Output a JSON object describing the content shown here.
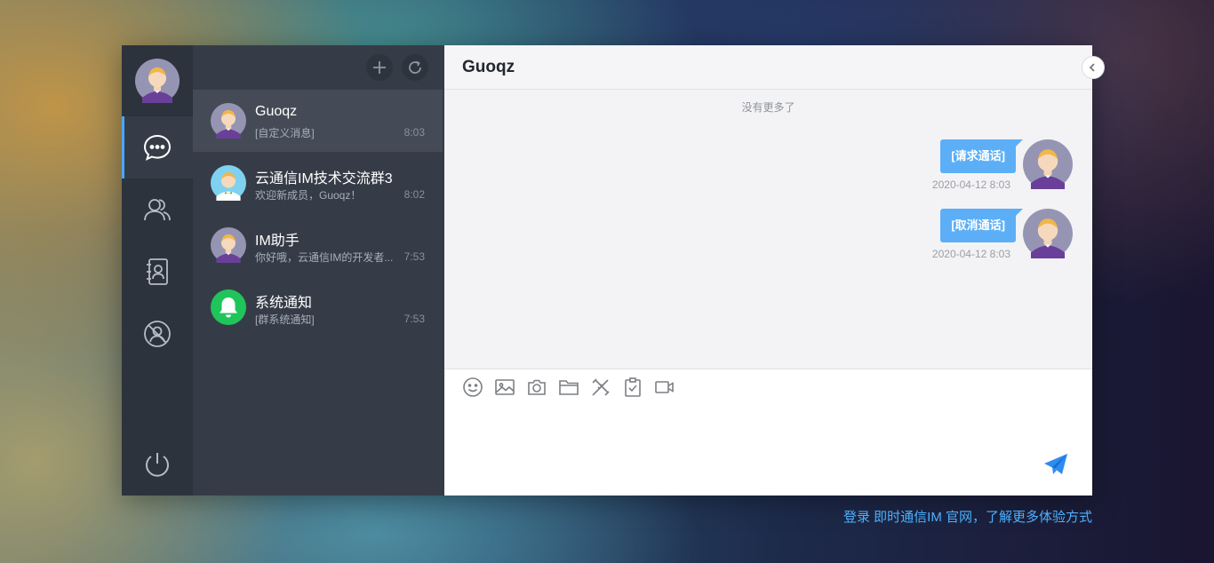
{
  "nav": {
    "items": [
      "chat",
      "contacts",
      "address-book",
      "profile"
    ],
    "power": "power"
  },
  "sessions": {
    "items": [
      {
        "name": "Guoqz",
        "preview": "[自定义消息]",
        "time": "8:03",
        "avatar": "purple-avatar"
      },
      {
        "name": "云通信IM技术交流群3",
        "preview": "欢迎新成员，Guoqz！",
        "time": "8:02",
        "avatar": "blue-avatar"
      },
      {
        "name": "IM助手",
        "preview": "你好哦，云通信IM的开发者...",
        "time": "7:53",
        "avatar": "purple-avatar"
      },
      {
        "name": "系统通知",
        "preview": "[群系统通知]",
        "time": "7:53",
        "avatar": "bell-avatar"
      }
    ]
  },
  "chat": {
    "title": "Guoqz",
    "no_more": "没有更多了",
    "messages": [
      {
        "text": "[请求通话]",
        "time": "2020-04-12 8:03"
      },
      {
        "text": "[取消通话]",
        "time": "2020-04-12 8:03"
      }
    ],
    "toolbar": [
      "emoji-icon",
      "image-icon",
      "camera-icon",
      "folder-icon",
      "custom-tool-icon",
      "survey-icon",
      "video-call-icon"
    ]
  },
  "footer": {
    "link_text": "登录 即时通信IM 官网，了解更多体验方式"
  },
  "colors": {
    "accent": "#5caff7",
    "nav_bg": "#2d333d",
    "list_bg": "#363c47",
    "link": "#4cb1ff"
  }
}
